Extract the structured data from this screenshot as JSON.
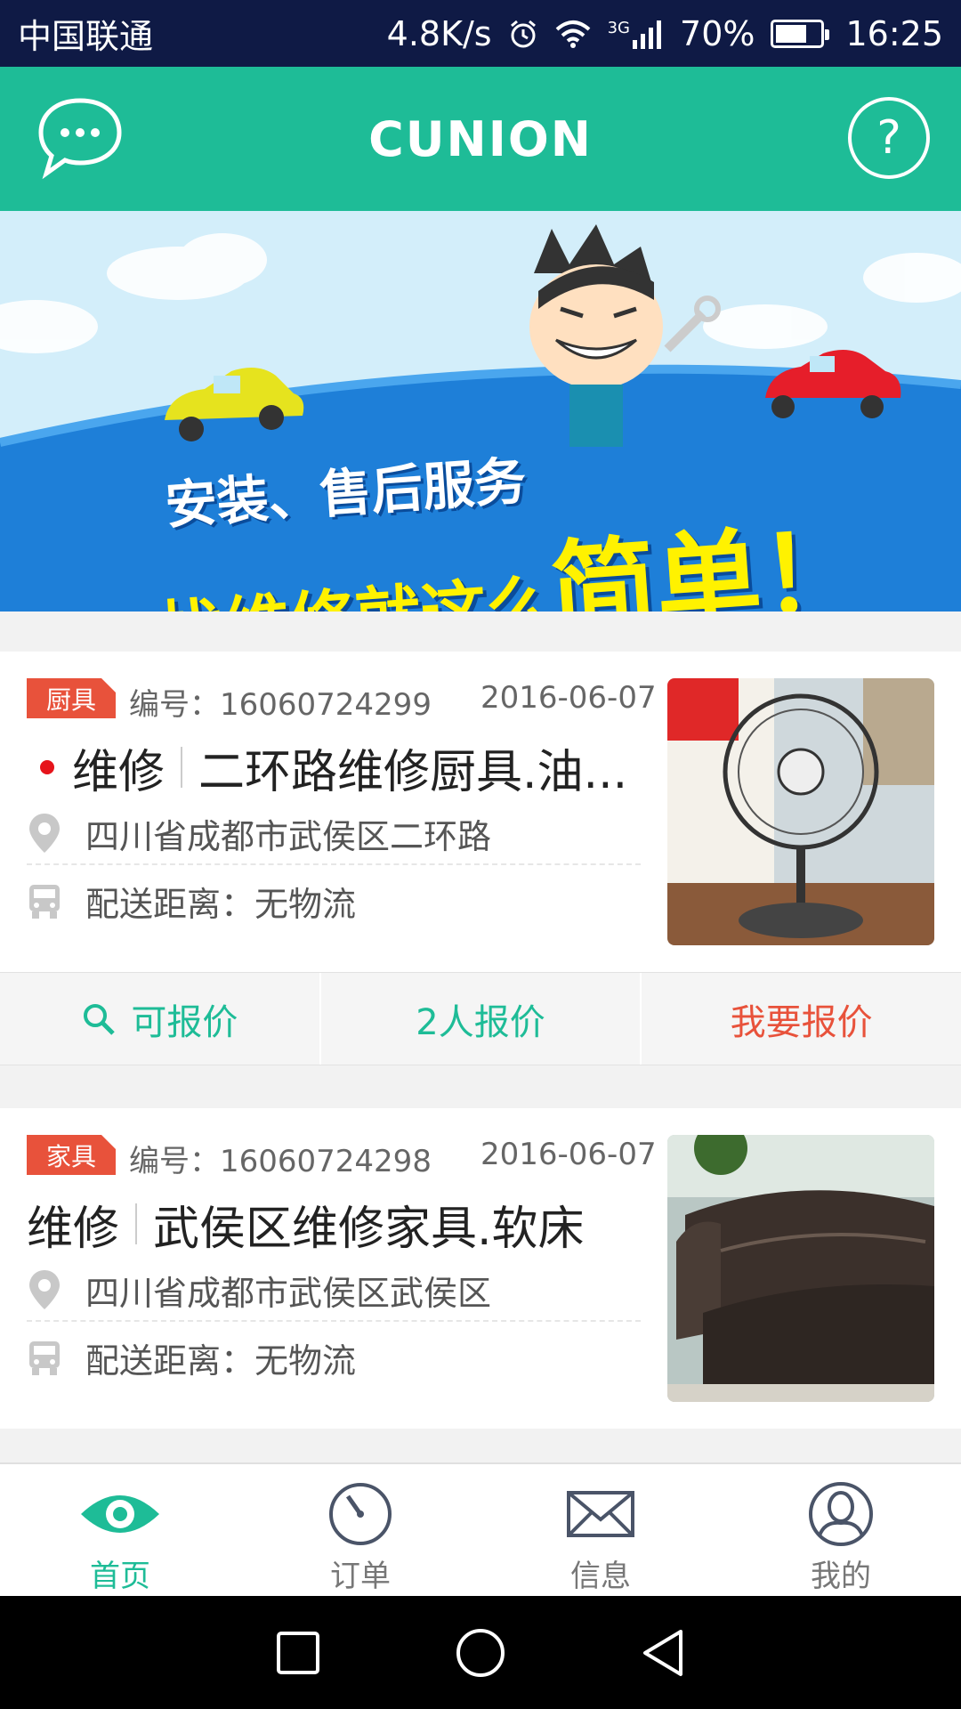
{
  "status_bar": {
    "carrier": "中国联通",
    "speed": "4.8K/s",
    "network": "3G",
    "battery": "70%",
    "battery_level": 0.7,
    "time": "16:25"
  },
  "header": {
    "title": "CUNION",
    "chat_icon": "chat-bubble-icon",
    "help_icon": "help-icon"
  },
  "banner": {
    "line1": "安装、售后服务",
    "line2_prefix": "找维修就这么",
    "line2_emphasis": "简单！"
  },
  "orders": [
    {
      "category": "厨具",
      "order_no": "编号：16060724299",
      "date": "2016-06-07",
      "unread": true,
      "service_type": "维修",
      "title": "二环路维修厨具.油...",
      "address": "四川省成都市武侯区二环路",
      "shipping": "配送距离：无物流",
      "image": "electric-fan-photo",
      "actions": {
        "status": "可报价",
        "quote_count": "2人报价",
        "quote_button": "我要报价"
      }
    },
    {
      "category": "家具",
      "order_no": "编号：16060724298",
      "date": "2016-06-07",
      "unread": false,
      "service_type": "维修",
      "title": "武侯区维修家具.软床",
      "address": "四川省成都市武侯区武侯区",
      "shipping": "配送距离：无物流",
      "image": "leather-sofa-photo"
    }
  ],
  "tabs": [
    {
      "label": "首页",
      "icon": "eye-icon",
      "active": true
    },
    {
      "label": "订单",
      "icon": "clock-icon",
      "active": false
    },
    {
      "label": "信息",
      "icon": "envelope-icon",
      "active": false
    },
    {
      "label": "我的",
      "icon": "user-icon",
      "active": false
    }
  ],
  "colors": {
    "accent": "#1ebc97",
    "status_bar": "#0f1a45",
    "highlight": "#e8523b"
  }
}
